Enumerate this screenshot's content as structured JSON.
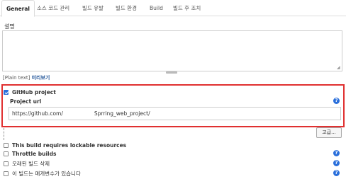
{
  "tabs": [
    {
      "label": "General",
      "active": true
    },
    {
      "label": "소스 코드 관리",
      "active": false
    },
    {
      "label": "빌드 유발",
      "active": false
    },
    {
      "label": "빌드 환경",
      "active": false
    },
    {
      "label": "Build",
      "active": false
    },
    {
      "label": "빌드 후 조치",
      "active": false
    }
  ],
  "description": {
    "label": "설명",
    "value": "",
    "plain_text": "[Plain text]",
    "preview_link": "미리보기"
  },
  "github": {
    "checkbox_label": "GitHub project",
    "checked": true,
    "project_url_label": "Project url",
    "url_part1": "https://github.com/",
    "url_part2": "Sprring_web_project/",
    "help": "?"
  },
  "advanced_button": "고급...",
  "options": [
    {
      "label": "This build requires lockable resources",
      "checked": false,
      "bold": true,
      "help": ""
    },
    {
      "label": "Throttle builds",
      "checked": false,
      "bold": true,
      "help": "?"
    },
    {
      "label": "오래된 빌드 삭제",
      "checked": false,
      "bold": false,
      "help": "?"
    },
    {
      "label": "이 빌드는 매개변수가 있습니다",
      "checked": false,
      "bold": false,
      "help": "?"
    }
  ],
  "colors": {
    "accent": "#2a6fdb",
    "highlight_border": "#e03030",
    "link": "#225599"
  },
  "icons": {
    "help": "help-icon",
    "checkbox": "checkbox-icon",
    "resize": "resize-grip-icon"
  }
}
